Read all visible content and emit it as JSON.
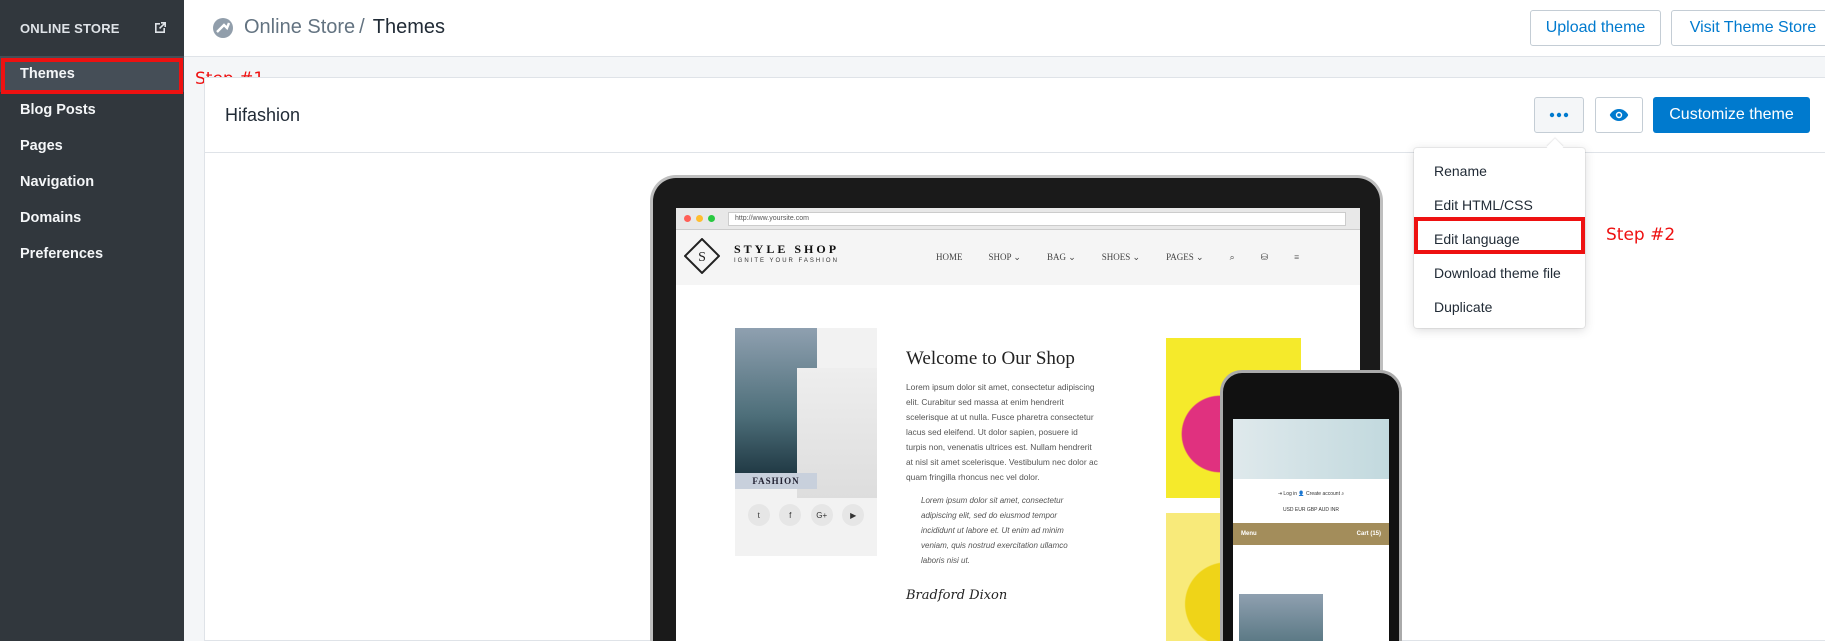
{
  "sidebar": {
    "header": "ONLINE STORE",
    "items": [
      {
        "label": "Themes",
        "active": true
      },
      {
        "label": "Blog Posts"
      },
      {
        "label": "Pages"
      },
      {
        "label": "Navigation"
      },
      {
        "label": "Domains"
      },
      {
        "label": "Preferences"
      }
    ]
  },
  "annotations": {
    "step1": "Step #1",
    "step2": "Step #2",
    "color": "#ee1111"
  },
  "header": {
    "parent": "Online Store",
    "separator": "/",
    "current": "Themes",
    "upload_label": "Upload theme",
    "visit_label": "Visit Theme Store"
  },
  "theme": {
    "name": "Hifashion",
    "customize_label": "Customize theme"
  },
  "dropdown": {
    "items": [
      "Rename",
      "Edit HTML/CSS",
      "Edit language",
      "Download theme file",
      "Duplicate"
    ]
  },
  "preview": {
    "url": "http://www.yoursite.com",
    "logo": "STYLE SHOP",
    "logo_sub": "IGNITE YOUR FASHION",
    "nav": [
      "HOME",
      "SHOP ⌄",
      "BAG ⌄",
      "SHOES ⌄",
      "PAGES ⌄",
      "⌕",
      "⛁",
      "≡"
    ],
    "welcome": "Welcome to Our Shop",
    "lorem": "Lorem ipsum dolor sit amet, consectetur adipiscing elit. Curabitur sed massa at enim hendrerit scelerisque at ut nulla. Fusce pharetra consectetur lacus sed eleifend. Ut dolor sapien, posuere id turpis non, venenatis ultrices est. Nullam hendrerit at nisl sit amet scelerisque. Vestibulum nec dolor ac quam fringilla rhoncus nec vel dolor.",
    "quote": "Lorem ipsum dolor sit amet, consectetur adipiscing elit, sed do eiusmod tempor incididunt ut labore et. Ut enim ad minim veniam, quis nostrud exercitation ullamco laboris nisi ut.",
    "signature": "Bradford Dixon",
    "fashion": "FASHION",
    "social": [
      "t",
      "f",
      "G+",
      "▶"
    ],
    "phone_links": "⇥ Log in   👤 Create account   ⌕",
    "phone_currency": "USD  EUR  GBP  AUD  INR",
    "phone_menu": "Menu",
    "phone_cart": "Cart (15)"
  },
  "colors": {
    "sidebar": "#31373d",
    "accent": "#007ace",
    "highlight": "#ee1111"
  }
}
